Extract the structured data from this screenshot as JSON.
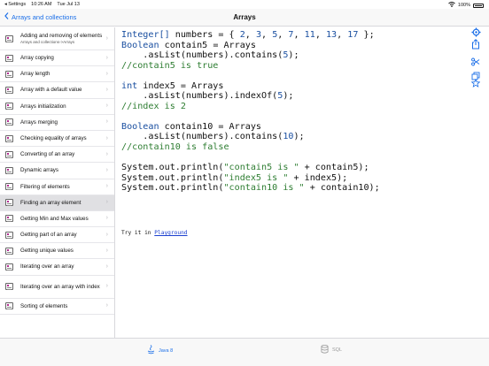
{
  "status": {
    "back": "◂ Settings",
    "time": "10:26 AM",
    "date": "Tue Jul 13",
    "battery": "100%"
  },
  "nav": {
    "back_label": "Arrays and collections",
    "title": "Arrays"
  },
  "sidebar": {
    "items": [
      {
        "label": "Adding and removing of elements",
        "sub": "Arrays and collections->Arrays"
      },
      {
        "label": "Array copying"
      },
      {
        "label": "Array length"
      },
      {
        "label": "Array with a default value"
      },
      {
        "label": "Arrays initialization"
      },
      {
        "label": "Arrays merging"
      },
      {
        "label": "Checking equality of arrays"
      },
      {
        "label": "Converting of an array"
      },
      {
        "label": "Dynamic arrays"
      },
      {
        "label": "Filtering of elements"
      },
      {
        "label": "Finding an array element",
        "selected": true
      },
      {
        "label": "Getting Min and Max values"
      },
      {
        "label": "Getting part of an array"
      },
      {
        "label": "Getting unique values"
      },
      {
        "label": "Iterating over an array"
      },
      {
        "label": "Iterating over an array with index"
      },
      {
        "label": "Sorting of elements"
      }
    ]
  },
  "code": {
    "l1_type": "Integer[]",
    "l1_rest": " numbers = { ",
    "l1_nums": [
      "2",
      "3",
      "5",
      "7",
      "11",
      "13",
      "17"
    ],
    "l1_end": " };",
    "l2_type": "Boolean",
    "l2_rest": " contain5 = Arrays",
    "l3_a": "    .asList(numbers).contains(",
    "l3_num": "5",
    "l3_end": ");",
    "l4": "//contain5 is true",
    "l6_type": "int",
    "l6_rest": " index5 = Arrays",
    "l7_a": "    .asList(numbers).indexOf(",
    "l7_num": "5",
    "l7_end": ");",
    "l8": "//index is 2",
    "l10_type": "Boolean",
    "l10_rest": " contain10 = Arrays",
    "l11_a": "    .asList(numbers).contains(",
    "l11_num": "10",
    "l11_end": ");",
    "l12": "//contain10 is false",
    "l14_a": "System.out.println(",
    "l14_str": "\"contain5 is \"",
    "l14_end": " + contain5);",
    "l15_a": "System.out.println(",
    "l15_str": "\"index5 is \"",
    "l15_end": " + index5);",
    "l16_a": "System.out.println(",
    "l16_str": "\"contain10 is \"",
    "l16_end": " + contain10);"
  },
  "try": {
    "prefix": "Try it in ",
    "link": "Playground"
  },
  "tabs": [
    {
      "label": "Java 8",
      "icon": "java-icon",
      "active": true
    },
    {
      "label": "SQL",
      "icon": "database-icon",
      "active": false
    }
  ],
  "colors": {
    "accent": "#1a6ee8",
    "keyword": "#1a4fa0",
    "string": "#2e7d32",
    "selected_row": "#e0e0e3"
  }
}
